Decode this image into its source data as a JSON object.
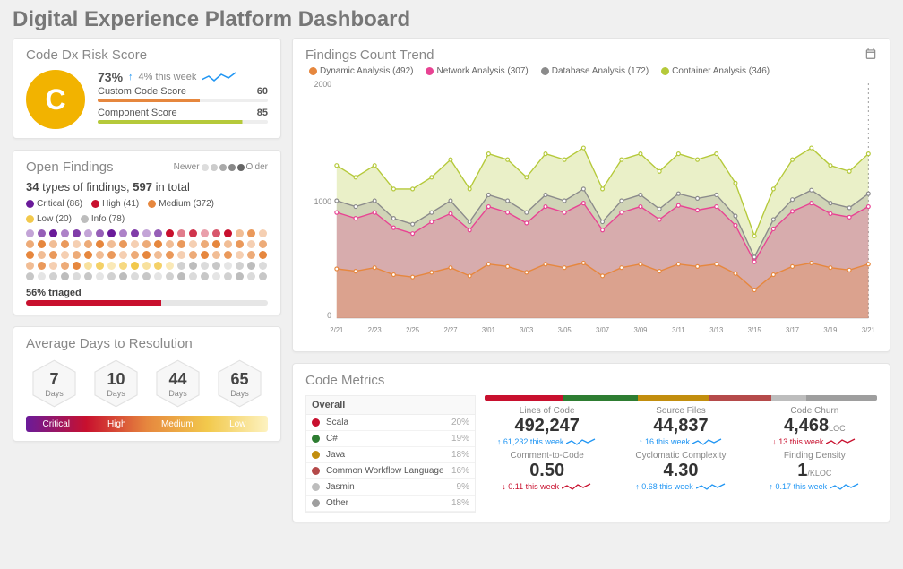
{
  "page_title": "Digital Experience Platform Dashboard",
  "risk": {
    "title": "Code Dx Risk Score",
    "grade": "C",
    "percent": "73%",
    "trend_arrow": "↑",
    "trend_text": "4% this week",
    "custom_label": "Custom Code Score",
    "custom_value": "60",
    "custom_color": "#e6873e",
    "component_label": "Component Score",
    "component_value": "85",
    "component_color": "#b5c93a"
  },
  "open": {
    "title": "Open Findings",
    "newer": "Newer",
    "older": "Older",
    "types": "34",
    "types_label": " types of findings, ",
    "total": "597",
    "total_label": " in total",
    "legend": [
      {
        "label": "Critical (86)",
        "color": "#6a1b9a"
      },
      {
        "label": "High (41)",
        "color": "#c8102e"
      },
      {
        "label": "Medium (372)",
        "color": "#e6873e"
      },
      {
        "label": "Low (20)",
        "color": "#f2c94c"
      },
      {
        "label": "Info (78)",
        "color": "#bdbdbd"
      }
    ],
    "triaged_label": "56% triaged",
    "triaged_pct": 56
  },
  "avg": {
    "title": "Average Days to Resolution",
    "unit": "Days",
    "values": [
      "7",
      "10",
      "44",
      "65"
    ],
    "sev": [
      "Critical",
      "High",
      "Medium",
      "Low"
    ]
  },
  "trend": {
    "title": "Findings Count Trend",
    "ymax_label": "2000",
    "ymid_label": "1000",
    "ymin_label": "0",
    "series": [
      {
        "name": "Dynamic Analysis (492)",
        "color": "#e6873e"
      },
      {
        "name": "Network Analysis (307)",
        "color": "#e84393"
      },
      {
        "name": "Database Analysis (172)",
        "color": "#8b8b8b"
      },
      {
        "name": "Container Analysis (346)",
        "color": "#b5c93a"
      }
    ],
    "x_ticks": [
      "2/21",
      "2/23",
      "2/25",
      "2/27",
      "3/01",
      "3/03",
      "3/05",
      "3/07",
      "3/09",
      "3/11",
      "3/13",
      "3/15",
      "3/17",
      "3/19",
      "3/21"
    ]
  },
  "code": {
    "title": "Code Metrics",
    "overall": "Overall",
    "langs": [
      {
        "name": "Scala",
        "pct": "20%",
        "color": "#c8102e"
      },
      {
        "name": "C#",
        "pct": "19%",
        "color": "#2e7d32"
      },
      {
        "name": "Java",
        "pct": "18%",
        "color": "#c28e0e"
      },
      {
        "name": "Common Workflow Language",
        "pct": "16%",
        "color": "#b54a4a"
      },
      {
        "name": "Jasmin",
        "pct": "9%",
        "color": "#bdbdbd"
      },
      {
        "name": "Other",
        "pct": "18%",
        "color": "#9e9e9e"
      }
    ],
    "metrics": [
      {
        "label": "Lines of Code",
        "value": "492,247",
        "delta": "61,232 this week",
        "dir": "up",
        "sup": ""
      },
      {
        "label": "Source Files",
        "value": "44,837",
        "delta": "16 this week",
        "dir": "up",
        "sup": ""
      },
      {
        "label": "Code Churn",
        "value": "4,468",
        "delta": "13 this week",
        "dir": "down",
        "sup": "LOC"
      },
      {
        "label": "Comment-to-Code",
        "value": "0.50",
        "delta": "0.11 this week",
        "dir": "down",
        "sup": ""
      },
      {
        "label": "Cyclomatic Complexity",
        "value": "4.30",
        "delta": "0.68 this week",
        "dir": "up",
        "sup": ""
      },
      {
        "label": "Finding Density",
        "value": "1",
        "delta": "0.17 this week",
        "dir": "up",
        "sup": "/KLOC"
      }
    ]
  },
  "chart_data": {
    "type": "area",
    "title": "Findings Count Trend",
    "ylabel": "",
    "ylim": [
      0,
      2000
    ],
    "x": [
      "2/21",
      "2/22",
      "2/23",
      "2/24",
      "2/25",
      "2/26",
      "2/27",
      "2/28",
      "3/01",
      "3/02",
      "3/03",
      "3/04",
      "3/05",
      "3/06",
      "3/07",
      "3/08",
      "3/09",
      "3/10",
      "3/11",
      "3/12",
      "3/13",
      "3/14",
      "3/15",
      "3/16",
      "3/17",
      "3/18",
      "3/19",
      "3/20",
      "3/21"
    ],
    "series": [
      {
        "name": "Container Analysis",
        "color": "#b5c93a",
        "values": [
          1300,
          1200,
          1300,
          1100,
          1100,
          1200,
          1350,
          1100,
          1400,
          1350,
          1200,
          1400,
          1350,
          1450,
          1100,
          1350,
          1400,
          1250,
          1400,
          1350,
          1400,
          1150,
          700,
          1100,
          1350,
          1450,
          1300,
          1250,
          1400
        ]
      },
      {
        "name": "Database Analysis",
        "color": "#8b8b8b",
        "values": [
          1000,
          950,
          1000,
          850,
          800,
          900,
          1000,
          820,
          1050,
          1000,
          900,
          1050,
          1000,
          1100,
          820,
          1000,
          1050,
          930,
          1060,
          1020,
          1050,
          870,
          520,
          840,
          1010,
          1090,
          980,
          940,
          1060
        ]
      },
      {
        "name": "Network Analysis",
        "color": "#e84393",
        "values": [
          900,
          850,
          900,
          770,
          720,
          820,
          890,
          750,
          950,
          900,
          810,
          950,
          900,
          980,
          750,
          900,
          950,
          840,
          960,
          920,
          950,
          790,
          480,
          760,
          910,
          980,
          890,
          860,
          950
        ]
      },
      {
        "name": "Dynamic Analysis",
        "color": "#e6873e",
        "values": [
          420,
          400,
          430,
          370,
          350,
          390,
          430,
          360,
          460,
          440,
          390,
          460,
          430,
          470,
          360,
          430,
          460,
          400,
          460,
          440,
          460,
          380,
          240,
          370,
          440,
          470,
          430,
          410,
          460
        ]
      }
    ]
  }
}
